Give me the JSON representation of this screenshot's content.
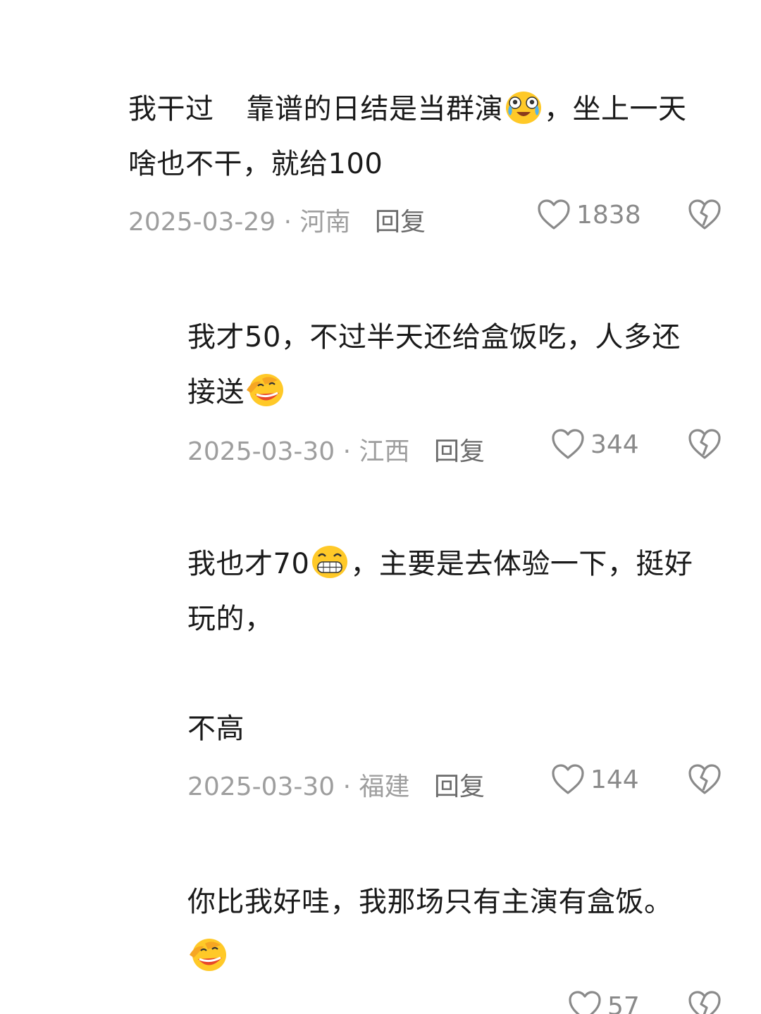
{
  "comments": [
    {
      "line1_a": "我干过",
      "line1_b": "靠谱的日结是当群演",
      "line1_c": "，坐上一天",
      "line2": "啥也不干，就给100",
      "date_loc": "2025-03-29 · 河南",
      "reply": "回复",
      "likes": "1838",
      "emoji": "crying-laughing-emoji"
    },
    {
      "line1": "我才50，不过半天还给盒饭吃，人多还",
      "line2": "接送",
      "date_loc": "2025-03-30 · 江西",
      "reply": "回复",
      "likes": "344",
      "emoji": "rolling-laughing-emoji"
    },
    {
      "line1_a": "我也才70",
      "line1_b": "，主要是去体验一下，挺好",
      "line2": "玩的，",
      "line3": "不高",
      "date_loc": "2025-03-30 · 福建",
      "reply": "回复",
      "likes": "144",
      "emoji": "grinning-emoji"
    },
    {
      "line1": "你比我好哇，我那场只有主演有盒饭。",
      "likes": "57",
      "emoji": "rolling-laughing-emoji"
    }
  ],
  "colors": {
    "text": "#1a1a1a",
    "meta": "#9e9e9e",
    "reply": "#6b6b6b",
    "icon": "#8a8a8a"
  }
}
